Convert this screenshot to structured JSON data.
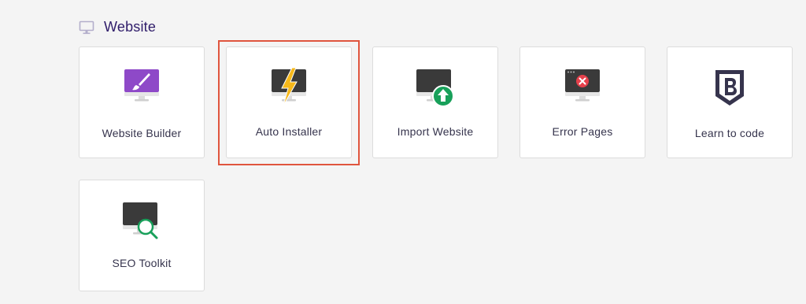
{
  "section": {
    "title": "Website",
    "icon": "monitor-icon"
  },
  "cards": [
    {
      "label": "Website Builder",
      "icon": "paintbrush-monitor-icon",
      "accent": "#8e49c8"
    },
    {
      "label": "Auto Installer",
      "icon": "lightning-monitor-icon",
      "accent": "#f6b81a",
      "highlighted": true
    },
    {
      "label": "Import Website",
      "icon": "upload-monitor-icon",
      "accent": "#18a05a"
    },
    {
      "label": "Error Pages",
      "icon": "error-monitor-icon",
      "accent": "#e5404b"
    },
    {
      "label": "Learn to code",
      "icon": "bootstrap-shield-icon",
      "accent": "#36344d"
    },
    {
      "label": "SEO Toolkit",
      "icon": "search-monitor-icon",
      "accent": "#18a05a"
    }
  ],
  "colors": {
    "highlight": "#e0553e",
    "title": "#2f1c6a"
  }
}
